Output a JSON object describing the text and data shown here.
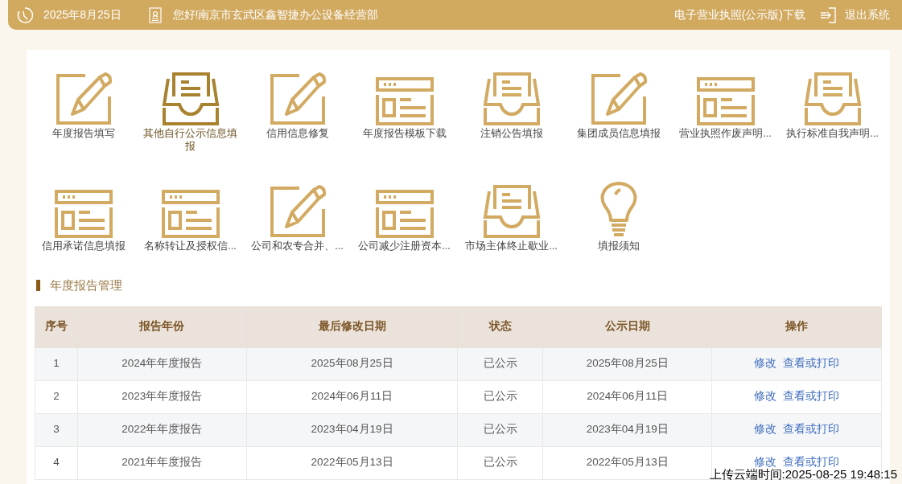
{
  "header": {
    "date": "2025年8月25日",
    "greeting": "您好!南京市玄武区鑫智捷办公设备经营部",
    "license_link": "电子营业执照(公示版)下载",
    "logout": "退出系统"
  },
  "tiles": [
    {
      "label": "年度报告填写",
      "kind": "pencil",
      "selected": false
    },
    {
      "label": "其他自行公示信息填报",
      "kind": "tray",
      "selected": true
    },
    {
      "label": "信用信息修复",
      "kind": "pencil",
      "selected": false
    },
    {
      "label": "年度报告模板下载",
      "kind": "form",
      "selected": false
    },
    {
      "label": "注销公告填报",
      "kind": "tray",
      "selected": false
    },
    {
      "label": "集团成员信息填报",
      "kind": "pencil",
      "selected": false
    },
    {
      "label": "营业执照作废声明...",
      "kind": "form",
      "selected": false
    },
    {
      "label": "执行标准自我声明...",
      "kind": "tray",
      "selected": false
    },
    {
      "label": "信用承诺信息填报",
      "kind": "form",
      "selected": false
    },
    {
      "label": "名称转让及授权信...",
      "kind": "form",
      "selected": false
    },
    {
      "label": "公司和农专合并、...",
      "kind": "pencil",
      "selected": false
    },
    {
      "label": "公司减少注册资本...",
      "kind": "form",
      "selected": false
    },
    {
      "label": "市场主体终止歇业...",
      "kind": "tray",
      "selected": false
    },
    {
      "label": "填报须知",
      "kind": "bulb",
      "selected": false
    }
  ],
  "section_title": "年度报告管理",
  "table": {
    "columns": [
      "序号",
      "报告年份",
      "最后修改日期",
      "状态",
      "公示日期",
      "操作"
    ],
    "rows": [
      {
        "cells": [
          "1",
          "2024年年度报告",
          "2025年08月25日",
          "已公示",
          "2025年08月25日"
        ],
        "actions": [
          "修改",
          "查看或打印"
        ]
      },
      {
        "cells": [
          "2",
          "2023年年度报告",
          "2024年06月11日",
          "已公示",
          "2024年06月11日"
        ],
        "actions": [
          "修改",
          "查看或打印"
        ]
      },
      {
        "cells": [
          "3",
          "2022年年度报告",
          "2023年04月19日",
          "已公示",
          "2023年04月19日"
        ],
        "actions": [
          "修改",
          "查看或打印"
        ]
      },
      {
        "cells": [
          "4",
          "2021年年度报告",
          "2022年05月13日",
          "已公示",
          "2022年05月13日"
        ],
        "actions": [
          "修改",
          "查看或打印"
        ]
      }
    ]
  },
  "upload_stamp": "上传云端时间:2025-08-25 19:48:15"
}
